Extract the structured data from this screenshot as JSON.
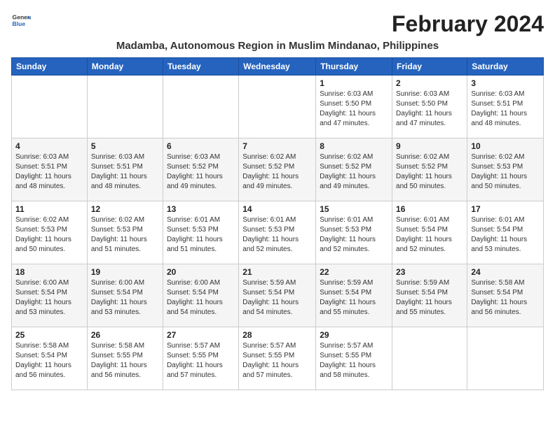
{
  "logo": {
    "line1": "General",
    "line2": "Blue"
  },
  "title": "February 2024",
  "location": "Madamba, Autonomous Region in Muslim Mindanao, Philippines",
  "weekdays": [
    "Sunday",
    "Monday",
    "Tuesday",
    "Wednesday",
    "Thursday",
    "Friday",
    "Saturday"
  ],
  "weeks": [
    [
      {
        "day": "",
        "info": ""
      },
      {
        "day": "",
        "info": ""
      },
      {
        "day": "",
        "info": ""
      },
      {
        "day": "",
        "info": ""
      },
      {
        "day": "1",
        "info": "Sunrise: 6:03 AM\nSunset: 5:50 PM\nDaylight: 11 hours and 47 minutes."
      },
      {
        "day": "2",
        "info": "Sunrise: 6:03 AM\nSunset: 5:50 PM\nDaylight: 11 hours and 47 minutes."
      },
      {
        "day": "3",
        "info": "Sunrise: 6:03 AM\nSunset: 5:51 PM\nDaylight: 11 hours and 48 minutes."
      }
    ],
    [
      {
        "day": "4",
        "info": "Sunrise: 6:03 AM\nSunset: 5:51 PM\nDaylight: 11 hours and 48 minutes."
      },
      {
        "day": "5",
        "info": "Sunrise: 6:03 AM\nSunset: 5:51 PM\nDaylight: 11 hours and 48 minutes."
      },
      {
        "day": "6",
        "info": "Sunrise: 6:03 AM\nSunset: 5:52 PM\nDaylight: 11 hours and 49 minutes."
      },
      {
        "day": "7",
        "info": "Sunrise: 6:02 AM\nSunset: 5:52 PM\nDaylight: 11 hours and 49 minutes."
      },
      {
        "day": "8",
        "info": "Sunrise: 6:02 AM\nSunset: 5:52 PM\nDaylight: 11 hours and 49 minutes."
      },
      {
        "day": "9",
        "info": "Sunrise: 6:02 AM\nSunset: 5:52 PM\nDaylight: 11 hours and 50 minutes."
      },
      {
        "day": "10",
        "info": "Sunrise: 6:02 AM\nSunset: 5:53 PM\nDaylight: 11 hours and 50 minutes."
      }
    ],
    [
      {
        "day": "11",
        "info": "Sunrise: 6:02 AM\nSunset: 5:53 PM\nDaylight: 11 hours and 50 minutes."
      },
      {
        "day": "12",
        "info": "Sunrise: 6:02 AM\nSunset: 5:53 PM\nDaylight: 11 hours and 51 minutes."
      },
      {
        "day": "13",
        "info": "Sunrise: 6:01 AM\nSunset: 5:53 PM\nDaylight: 11 hours and 51 minutes."
      },
      {
        "day": "14",
        "info": "Sunrise: 6:01 AM\nSunset: 5:53 PM\nDaylight: 11 hours and 52 minutes."
      },
      {
        "day": "15",
        "info": "Sunrise: 6:01 AM\nSunset: 5:53 PM\nDaylight: 11 hours and 52 minutes."
      },
      {
        "day": "16",
        "info": "Sunrise: 6:01 AM\nSunset: 5:54 PM\nDaylight: 11 hours and 52 minutes."
      },
      {
        "day": "17",
        "info": "Sunrise: 6:01 AM\nSunset: 5:54 PM\nDaylight: 11 hours and 53 minutes."
      }
    ],
    [
      {
        "day": "18",
        "info": "Sunrise: 6:00 AM\nSunset: 5:54 PM\nDaylight: 11 hours and 53 minutes."
      },
      {
        "day": "19",
        "info": "Sunrise: 6:00 AM\nSunset: 5:54 PM\nDaylight: 11 hours and 53 minutes."
      },
      {
        "day": "20",
        "info": "Sunrise: 6:00 AM\nSunset: 5:54 PM\nDaylight: 11 hours and 54 minutes."
      },
      {
        "day": "21",
        "info": "Sunrise: 5:59 AM\nSunset: 5:54 PM\nDaylight: 11 hours and 54 minutes."
      },
      {
        "day": "22",
        "info": "Sunrise: 5:59 AM\nSunset: 5:54 PM\nDaylight: 11 hours and 55 minutes."
      },
      {
        "day": "23",
        "info": "Sunrise: 5:59 AM\nSunset: 5:54 PM\nDaylight: 11 hours and 55 minutes."
      },
      {
        "day": "24",
        "info": "Sunrise: 5:58 AM\nSunset: 5:54 PM\nDaylight: 11 hours and 56 minutes."
      }
    ],
    [
      {
        "day": "25",
        "info": "Sunrise: 5:58 AM\nSunset: 5:54 PM\nDaylight: 11 hours and 56 minutes."
      },
      {
        "day": "26",
        "info": "Sunrise: 5:58 AM\nSunset: 5:55 PM\nDaylight: 11 hours and 56 minutes."
      },
      {
        "day": "27",
        "info": "Sunrise: 5:57 AM\nSunset: 5:55 PM\nDaylight: 11 hours and 57 minutes."
      },
      {
        "day": "28",
        "info": "Sunrise: 5:57 AM\nSunset: 5:55 PM\nDaylight: 11 hours and 57 minutes."
      },
      {
        "day": "29",
        "info": "Sunrise: 5:57 AM\nSunset: 5:55 PM\nDaylight: 11 hours and 58 minutes."
      },
      {
        "day": "",
        "info": ""
      },
      {
        "day": "",
        "info": ""
      }
    ]
  ]
}
